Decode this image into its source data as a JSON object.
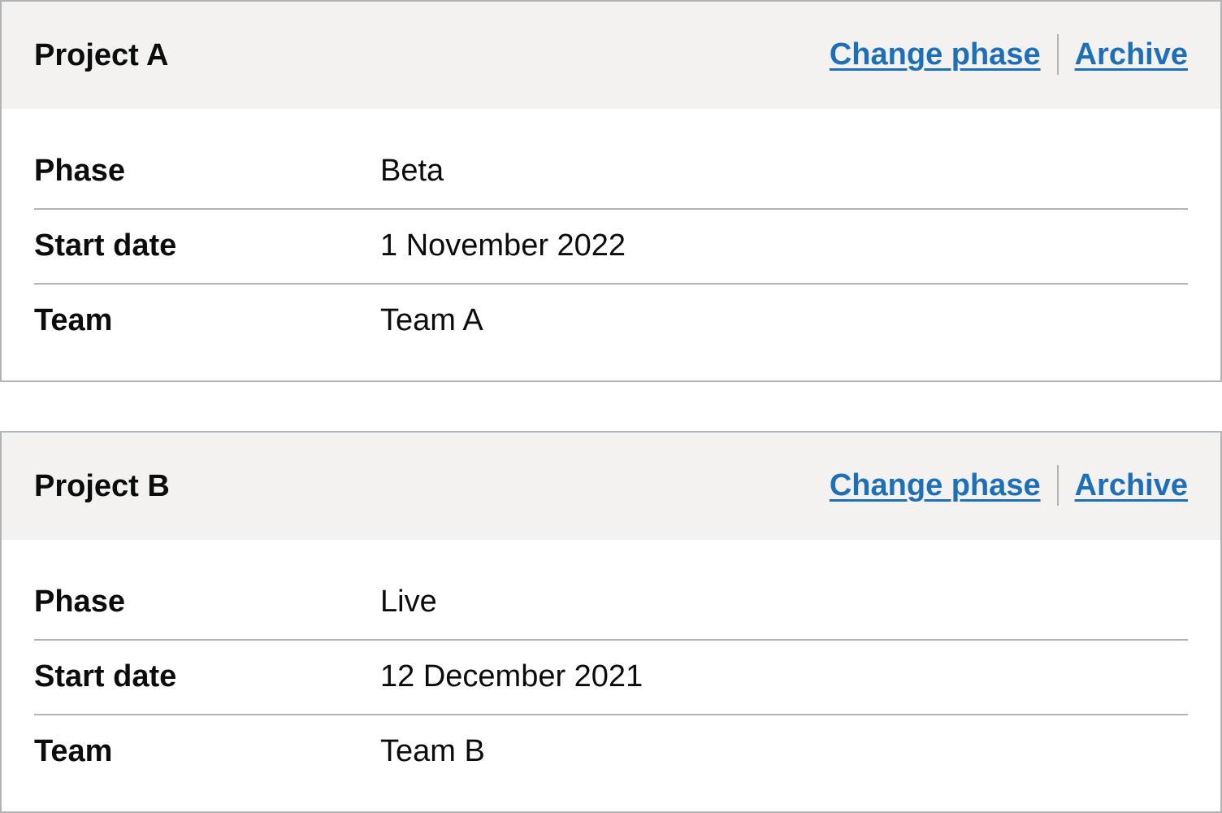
{
  "projects": [
    {
      "title": "Project A",
      "actions": {
        "change_phase": "Change phase",
        "archive": "Archive"
      },
      "rows": [
        {
          "key": "Phase",
          "value": "Beta"
        },
        {
          "key": "Start date",
          "value": "1 November 2022"
        },
        {
          "key": "Team",
          "value": "Team A"
        }
      ]
    },
    {
      "title": "Project B",
      "actions": {
        "change_phase": "Change phase",
        "archive": "Archive"
      },
      "rows": [
        {
          "key": "Phase",
          "value": "Live"
        },
        {
          "key": "Start date",
          "value": "12 December 2021"
        },
        {
          "key": "Team",
          "value": "Team B"
        }
      ]
    }
  ],
  "colors": {
    "link": "#1d70b8",
    "header_background": "#f3f2f1",
    "border": "#b1b4b6",
    "text": "#0b0c0c"
  }
}
